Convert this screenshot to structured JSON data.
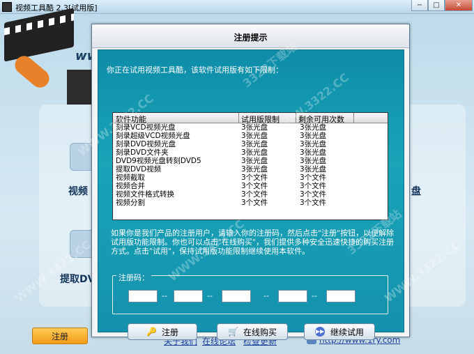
{
  "window": {
    "title": "视频工具酷 2.3[试用版]",
    "buttons": [
      "−",
      "□",
      "✕"
    ]
  },
  "background": {
    "logo_fragment": "ww",
    "features": [
      {
        "label": "视频",
        "icon": "film-icon"
      },
      {
        "label": "提取DV",
        "icon": "disc-icon"
      },
      {
        "label": "盘",
        "icon": ""
      }
    ],
    "register_button": "注册",
    "links": [
      "关于我们",
      "在线论坛",
      "检查更新",
      "http://www.1ry.com"
    ]
  },
  "dialog": {
    "title": "注册提示",
    "intro": "你正在试用视频工具酷，该软件试用版有如下限制：",
    "table": {
      "headers": [
        "软件功能",
        "试用版限制",
        "剩余可用次数"
      ],
      "rows": [
        [
          "刻录VCD视频光盘",
          "3张光盘",
          "3张光盘"
        ],
        [
          "刻录超级VCD视频光盘",
          "3张光盘",
          "3张光盘"
        ],
        [
          "刻录DVD视频光盘",
          "3张光盘",
          "3张光盘"
        ],
        [
          "刻录DVD文件夹",
          "3张光盘",
          "3张光盘"
        ],
        [
          "DVD9视频光盘转刻DVD5",
          "3张光盘",
          "3张光盘"
        ],
        [
          "提取DVD视频",
          "3张光盘",
          "3张光盘"
        ],
        [
          "视频截取",
          "3个文件",
          "3个文件"
        ],
        [
          "视频合并",
          "3个文件",
          "3个文件"
        ],
        [
          "视频文件格式转换",
          "3个文件",
          "3个文件"
        ],
        [
          "视频分割",
          "3个文件",
          "3个文件"
        ]
      ]
    },
    "note": "如果你是我们产品的注册用户，请输入你的注册码，然后点击\"注册\"按钮，以便解除试用版功能限制。你也可以点击\"在线购买\"，我们提供多种安全迅速快捷的购买注册方式。点击\"试用\"，保持试用版功能限制继续使用本软件。",
    "code": {
      "legend": "注册码：",
      "fields": [
        "",
        "",
        "",
        "",
        ""
      ],
      "separators": [
        "--",
        "--",
        "--",
        "--"
      ]
    },
    "buttons": {
      "register": "注册",
      "buy": "在线购买",
      "trial": "继续试用"
    }
  },
  "watermark": "WWW.3322.CC",
  "watermark2": "3322下载站"
}
